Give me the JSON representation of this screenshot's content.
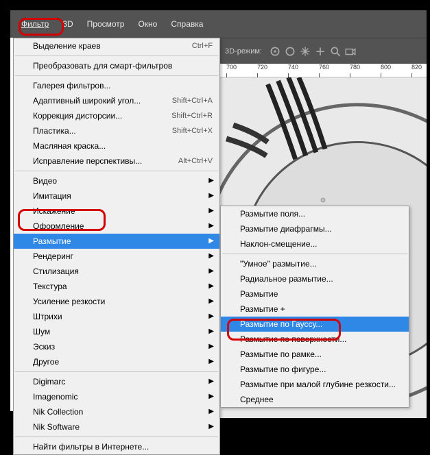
{
  "menubar": {
    "filter": "Фильтр",
    "three_d": "3D",
    "view": "Просмотр",
    "window": "Окно",
    "help": "Справка"
  },
  "toolbar": {
    "mode_label": "3D-режим:"
  },
  "ruler": {
    "t0": "700",
    "t1": "720",
    "t2": "740",
    "t3": "760",
    "t4": "780",
    "t5": "800",
    "t6": "820"
  },
  "dropdown": {
    "last": {
      "label": "Выделение краев",
      "shortcut": "Ctrl+F"
    },
    "smart": {
      "label": "Преобразовать для смарт-фильтров"
    },
    "gallery": {
      "label": "Галерея фильтров..."
    },
    "wide": {
      "label": "Адаптивный широкий угол...",
      "shortcut": "Shift+Ctrl+A"
    },
    "lens": {
      "label": "Коррекция дисторсии...",
      "shortcut": "Shift+Ctrl+R"
    },
    "liquify": {
      "label": "Пластика...",
      "shortcut": "Shift+Ctrl+X"
    },
    "oil": {
      "label": "Масляная краска..."
    },
    "vanish": {
      "label": "Исправление перспективы...",
      "shortcut": "Alt+Ctrl+V"
    },
    "video": {
      "label": "Видео"
    },
    "imitation": {
      "label": "Имитация"
    },
    "distort": {
      "label": "Искажение"
    },
    "stylize0": {
      "label": "Оформление"
    },
    "blur": {
      "label": "Размытие"
    },
    "render": {
      "label": "Рендеринг"
    },
    "stylize": {
      "label": "Стилизация"
    },
    "texture": {
      "label": "Текстура"
    },
    "sharpen": {
      "label": "Усиление резкости"
    },
    "strokes": {
      "label": "Штрихи"
    },
    "noise": {
      "label": "Шум"
    },
    "sketch": {
      "label": "Эскиз"
    },
    "other": {
      "label": "Другое"
    },
    "digimarc": {
      "label": "Digimarc"
    },
    "imagenomic": {
      "label": "Imagenomic"
    },
    "nik": {
      "label": "Nik Collection"
    },
    "niksoft": {
      "label": "Nik Software"
    },
    "online": {
      "label": "Найти фильтры в Интернете..."
    }
  },
  "submenu": {
    "field": "Размытие поля...",
    "iris": "Размытие диафрагмы...",
    "tilt": "Наклон-смещение...",
    "smart": "\"Умное\" размытие...",
    "radial": "Радиальное размытие...",
    "blur": "Размытие",
    "more": "Размытие +",
    "gauss": "Размытие по Гауссу...",
    "surface": "Размытие по поверхности...",
    "box": "Размытие по рамке...",
    "shape": "Размытие по фигуре...",
    "dof": "Размытие при малой глубине резкости...",
    "average": "Среднее"
  }
}
